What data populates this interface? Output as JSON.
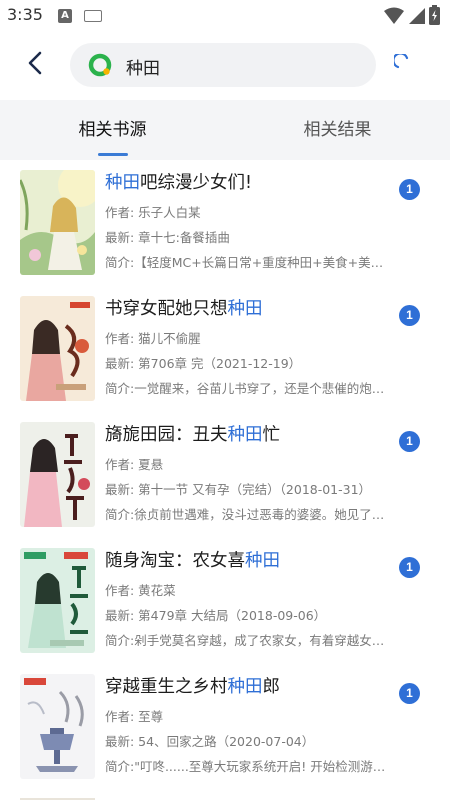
{
  "status_bar": {
    "time": "3:35",
    "notif_letter": "A"
  },
  "search": {
    "query": "种田"
  },
  "tabs": [
    {
      "label": "相关书源",
      "active": true
    },
    {
      "label": "相关结果",
      "active": false
    }
  ],
  "colors": {
    "accent": "#2f6fd6",
    "logo_green": "#2bb24c",
    "logo_yellow": "#f5b400",
    "tab_bg": "#f4f5f7"
  },
  "books": [
    {
      "title_pre": "",
      "title_hl": "种田",
      "title_post": "吧综漫少女们!",
      "author": "作者: 乐子人白某",
      "latest": "最新: 章十七:备餐插曲",
      "intro": "简介:【轻度MC+长篇日常+重度种田+美食+美少女...",
      "badge": "1"
    },
    {
      "title_pre": "书穿女配她只想",
      "title_hl": "种田",
      "title_post": "",
      "author": "作者: 猫儿不偷腥",
      "latest": "最新: 第706章 完（2021-12-19）",
      "intro": "简介:一觉醒来，谷苗儿书穿了，还是个悲催的炮灰...",
      "badge": "1"
    },
    {
      "title_pre": "旖旎田园：丑夫",
      "title_hl": "种田",
      "title_post": "忙",
      "author": "作者: 夏悬",
      "latest": "最新: 第十一节 又有孕（完结）（2018-01-31）",
      "intro": "简介:徐贞前世遇难，没斗过恶毒的婆婆。她见了全...",
      "badge": "1"
    },
    {
      "title_pre": "随身淘宝：农女喜",
      "title_hl": "种田",
      "title_post": "",
      "author": "作者: 黄花菜",
      "latest": "最新: 第479章 大结局（2018-09-06）",
      "intro": "简介:剁手党莫名穿越，成了农家女，有着穿越女主...",
      "badge": "1"
    },
    {
      "title_pre": "穿越重生之乡村",
      "title_hl": "种田",
      "title_post": "郎",
      "author": "作者: 至尊",
      "latest": "最新: 54、回家之路（2020-07-04）",
      "intro": "简介:\"叮咚......至尊大玩家系统开启! 开始检测游戏...",
      "badge": "1"
    }
  ]
}
